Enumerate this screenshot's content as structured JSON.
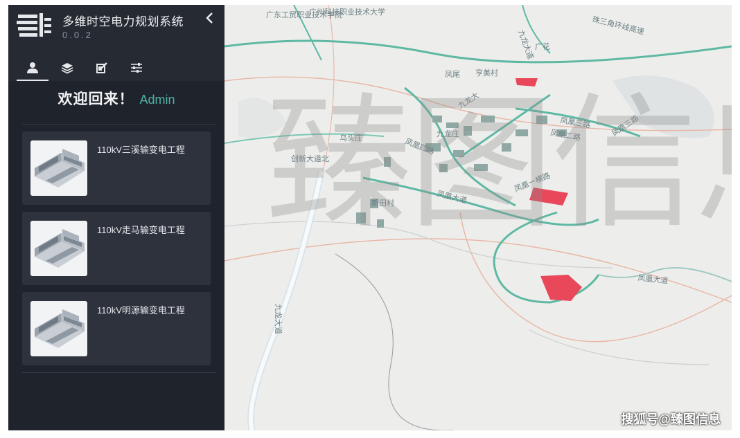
{
  "app": {
    "title": "多维时空电力规划系统",
    "version": "0.0.2",
    "collapse_icon": "chevron-left-icon"
  },
  "tabs": [
    {
      "icon": "user-icon",
      "active": true
    },
    {
      "icon": "layers-icon",
      "active": false
    },
    {
      "icon": "edit-icon",
      "active": false
    },
    {
      "icon": "sliders-icon",
      "active": false
    }
  ],
  "welcome": {
    "text": "欢迎回来！",
    "user": "Admin"
  },
  "projects": [
    {
      "title": "110kV三溪输变电工程",
      "thumbnail_icon": "substation-model-icon"
    },
    {
      "title": "110kV走马输变电工程",
      "thumbnail_icon": "substation-model-icon"
    },
    {
      "title": "110kV明源输变电工程",
      "thumbnail_icon": "substation-model-icon"
    }
  ],
  "map": {
    "labels": [
      "广东工贸职业技术学院",
      "广州科技职业技术大学",
      "珠三角环线高速",
      "九龙大道",
      "广花",
      "凤尾",
      "亨美村",
      "九龙大",
      "凤凰三路",
      "凤凰三路",
      "凤凰二路",
      "九龙庄",
      "乌头庄",
      "凤凰四路",
      "创新大道北",
      "凤凰一横路",
      "凤凰大道",
      "新田村",
      "凤凰大道",
      "九龙大道"
    ],
    "highlight_color": "#e8485a",
    "road_color": "#5fb8a4",
    "watermark": "臻图信息",
    "credit": "搜狐号@臻图信息"
  }
}
